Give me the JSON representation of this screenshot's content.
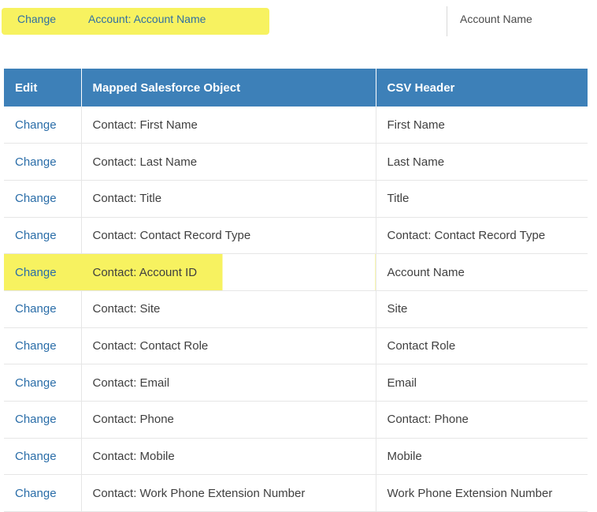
{
  "top_row": {
    "change_label": "Change",
    "mapped_object": "Account: Account Name",
    "csv_header": "Account Name"
  },
  "table": {
    "headers": [
      "Edit",
      "Mapped Salesforce Object",
      "CSV Header"
    ],
    "rows": [
      {
        "edit": "Change",
        "mapped": "Contact: First Name",
        "csv": "First Name",
        "highlighted": false
      },
      {
        "edit": "Change",
        "mapped": "Contact: Last Name",
        "csv": "Last Name",
        "highlighted": false
      },
      {
        "edit": "Change",
        "mapped": "Contact: Title",
        "csv": "Title",
        "highlighted": false
      },
      {
        "edit": "Change",
        "mapped": "Contact: Contact Record Type",
        "csv": "Contact: Contact Record Type",
        "highlighted": false
      },
      {
        "edit": "Change",
        "mapped": "Contact: Account ID",
        "csv": "Account Name",
        "highlighted": true
      },
      {
        "edit": "Change",
        "mapped": "Contact: Site",
        "csv": "Site",
        "highlighted": false
      },
      {
        "edit": "Change",
        "mapped": "Contact: Contact Role",
        "csv": "Contact Role",
        "highlighted": false
      },
      {
        "edit": "Change",
        "mapped": "Contact: Email",
        "csv": "Email",
        "highlighted": false
      },
      {
        "edit": "Change",
        "mapped": "Contact: Phone",
        "csv": "Contact: Phone",
        "highlighted": false
      },
      {
        "edit": "Change",
        "mapped": "Contact: Mobile",
        "csv": "Mobile",
        "highlighted": false
      },
      {
        "edit": "Change",
        "mapped": "Contact: Work Phone Extension Number",
        "csv": "Work Phone Extension Number",
        "highlighted": false
      }
    ]
  },
  "colors": {
    "header_bg": "#3d80b8",
    "link": "#2a6da8",
    "highlight": "#f7f260"
  }
}
